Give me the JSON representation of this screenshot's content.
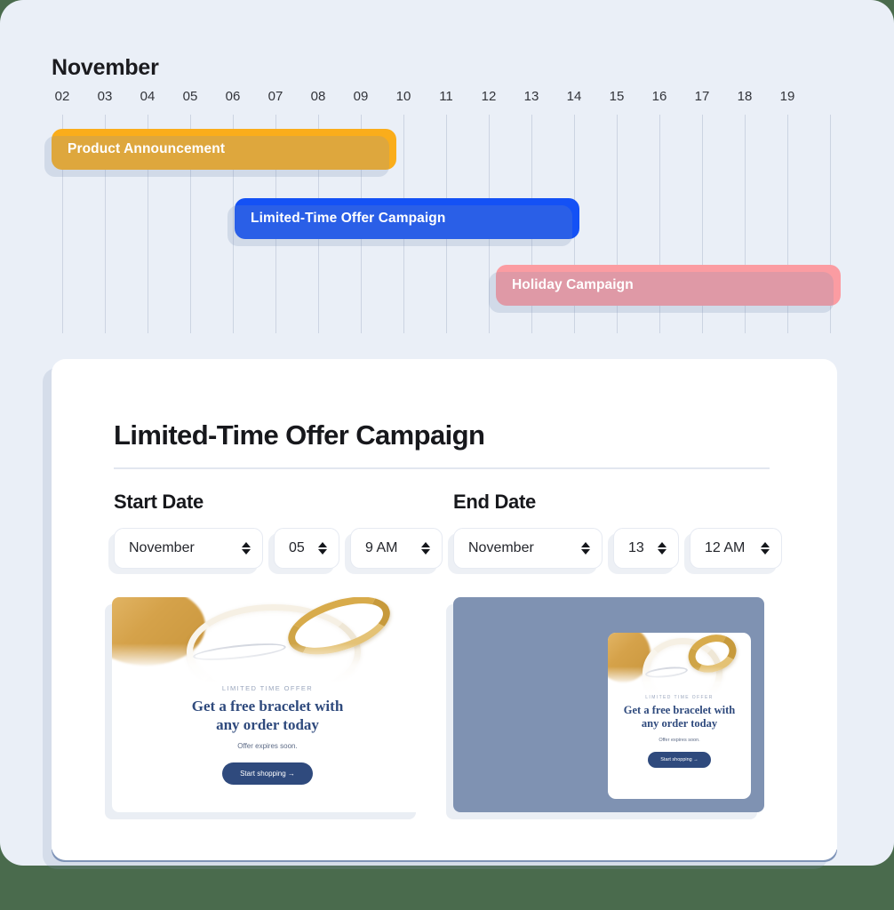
{
  "timeline": {
    "month": "November",
    "days": [
      "02",
      "03",
      "04",
      "05",
      "06",
      "07",
      "08",
      "09",
      "10",
      "11",
      "12",
      "13",
      "14",
      "15",
      "16",
      "17",
      "18",
      "19"
    ],
    "bars": [
      {
        "label": "Product Announcement",
        "color": "#FAAD1B",
        "start_day": "02",
        "end_day": "09"
      },
      {
        "label": "Limited-Time Offer Campaign",
        "color": "#1451F5",
        "start_day": "06",
        "end_day": "14"
      },
      {
        "label": "Holiday Campaign",
        "color": "#FB9CA2",
        "start_day": "12",
        "end_day": "19"
      }
    ]
  },
  "detail": {
    "title": "Limited-Time Offer Campaign",
    "start_date": {
      "label": "Start Date",
      "month": "November",
      "day": "05",
      "time": "9 AM"
    },
    "end_date": {
      "label": "End Date",
      "month": "November",
      "day": "13",
      "time": "12 AM"
    }
  },
  "email_preview": {
    "eyebrow": "LIMITED TIME OFFER",
    "headline_line1": "Get a free bracelet with",
    "headline_line2": "any order today",
    "subcopy": "Offer expires soon.",
    "cta": "Start shopping  →"
  },
  "colors": {
    "page_background": "#eaeff7",
    "outer_background": "#4a6b4d",
    "card_background": "#ffffff",
    "accent_orange": "#FAAD1B",
    "accent_blue": "#1451F5",
    "accent_pink": "#FB9CA2",
    "slate": "#7f92b2",
    "brand_navy": "#2f4a7d"
  }
}
